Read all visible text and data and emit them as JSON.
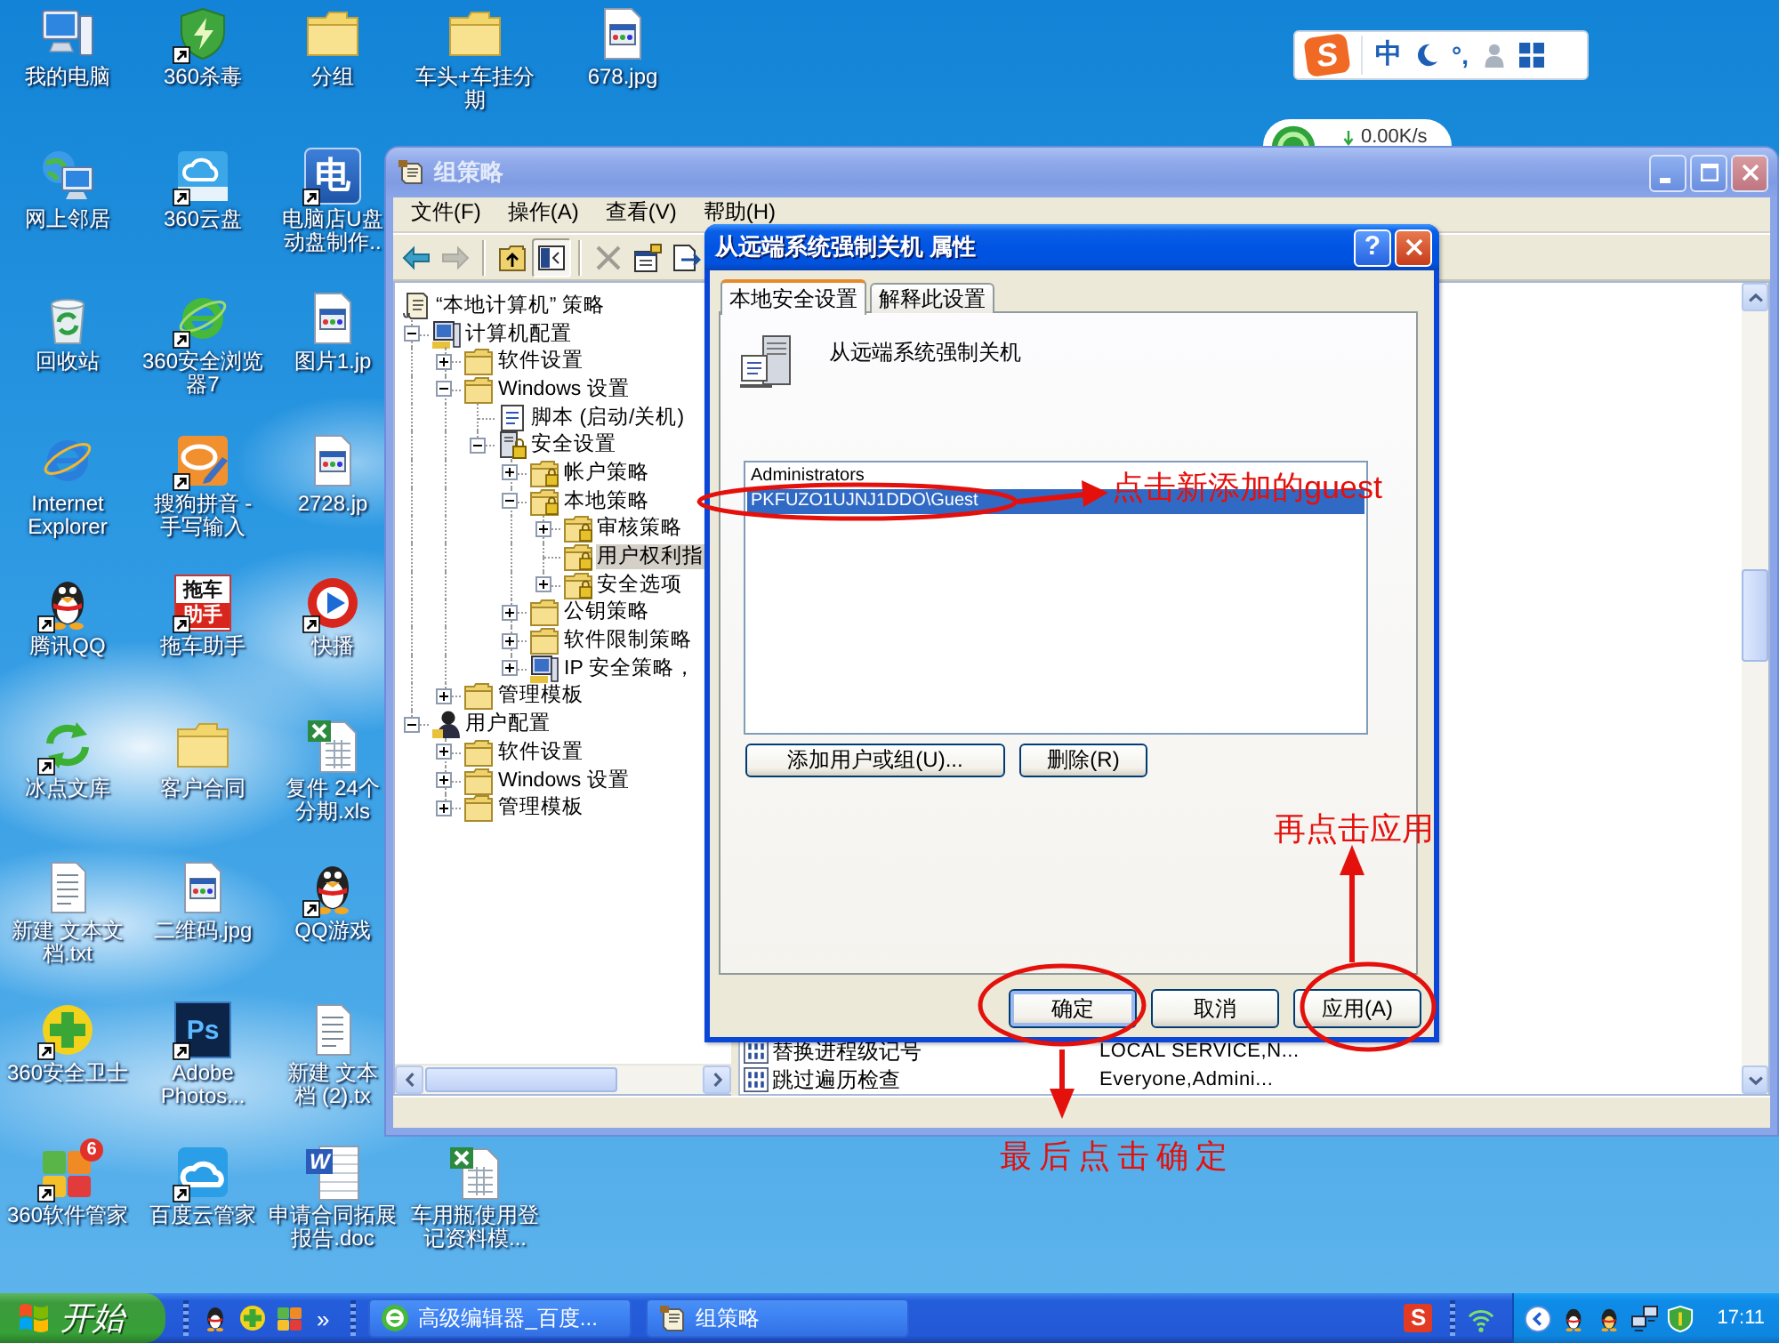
{
  "desktop_icons": [
    [
      {
        "label": "我的电脑",
        "kind": "computer",
        "shortcut": false
      },
      {
        "label": "网上邻居",
        "kind": "network",
        "shortcut": false
      },
      {
        "label": "回收站",
        "kind": "recycle",
        "shortcut": false
      },
      {
        "label": "Internet Explorer",
        "kind": "ie",
        "shortcut": false
      },
      {
        "label": "腾讯QQ",
        "kind": "penguin",
        "shortcut": true
      },
      {
        "label": "冰点文库",
        "kind": "arrows",
        "shortcut": true
      },
      {
        "label": "新建 文本文档.txt",
        "kind": "textfile",
        "shortcut": false
      },
      {
        "label": "360安全卫士",
        "kind": "plus",
        "shortcut": true
      },
      {
        "label": "360软件管家",
        "kind": "apps",
        "shortcut": true,
        "badge": "6"
      }
    ],
    [
      {
        "label": "360杀毒",
        "kind": "shield",
        "shortcut": true
      },
      {
        "label": "360云盘",
        "kind": "cloud",
        "shortcut": true
      },
      {
        "label": "360安全浏览器7",
        "kind": "ering",
        "shortcut": true
      },
      {
        "label": "搜狗拼音 - 手写输入",
        "kind": "pencil",
        "shortcut": true
      },
      {
        "label": "拖车助手",
        "kind": "tow-tile",
        "tile_text": [
          "拖车",
          "助手"
        ],
        "shortcut": true
      },
      {
        "label": "客户合同",
        "kind": "folder",
        "shortcut": false
      },
      {
        "label": "二维码.jpg",
        "kind": "image",
        "shortcut": false
      },
      {
        "label": "Adobe Photos...",
        "kind": "ps-tile",
        "tile_text": [
          "Ps"
        ],
        "shortcut": true
      },
      {
        "label": "百度云管家",
        "kind": "cloud2",
        "shortcut": true
      }
    ],
    [
      {
        "label": "分组",
        "kind": "folder",
        "shortcut": false
      },
      {
        "label": "电脑店U盘动盘制作..",
        "kind": "char-tile",
        "tile_text": [
          "电"
        ],
        "shortcut": true
      },
      {
        "label": "图片1.jp",
        "kind": "image",
        "shortcut": false
      },
      {
        "label": "2728.jp",
        "kind": "image",
        "shortcut": false
      },
      {
        "label": "快播",
        "kind": "play",
        "shortcut": true
      },
      {
        "label": "复件 24个分期.xls",
        "kind": "excel",
        "shortcut": false
      },
      {
        "label": "QQ游戏",
        "kind": "penguin",
        "shortcut": true
      },
      {
        "label": "新建 文本档 (2).tx",
        "kind": "textfile",
        "shortcut": false
      },
      {
        "label": "申请合同拓展报告.doc",
        "kind": "word-doc",
        "tile_text": [
          "W"
        ],
        "shortcut": false
      }
    ],
    [
      {
        "label": "车头+车挂分期",
        "kind": "folder",
        "shortcut": false
      },
      {
        "label": "车用瓶使用登记资料模...",
        "kind": "excel",
        "shortcut": false
      }
    ],
    [
      {
        "label": "678.jpg",
        "kind": "image",
        "shortcut": false
      }
    ]
  ],
  "ime_bar": {
    "logo": "S",
    "mode": "中",
    "punctuation": "°,"
  },
  "net_widget": {
    "speed": "0.00K/s"
  },
  "gp_window": {
    "title": "组策略",
    "menu": [
      "文件(F)",
      "操作(A)",
      "查看(V)",
      "帮助(H)"
    ],
    "toolbar": [
      [
        {
          "kind": "back",
          "disabled": false,
          "pressed": false
        },
        {
          "kind": "forward",
          "disabled": true,
          "pressed": false
        }
      ],
      [
        {
          "kind": "up",
          "disabled": false,
          "pressed": false
        },
        {
          "kind": "tree",
          "disabled": false,
          "pressed": true
        }
      ],
      [
        {
          "kind": "delete",
          "disabled": true,
          "pressed": false
        },
        {
          "kind": "properties",
          "disabled": false,
          "pressed": false
        },
        {
          "kind": "export",
          "disabled": false,
          "pressed": false
        }
      ]
    ],
    "tree": {
      "label": "“本地计算机” 策略",
      "kind": "policy",
      "selected": false,
      "children": [
        {
          "label": "计算机配置",
          "kind": "computer",
          "expanded": true,
          "selected": false,
          "children": [
            {
              "label": "软件设置",
              "kind": "folder",
              "expanded": false,
              "selected": false
            },
            {
              "label": "Windows 设置",
              "kind": "folder",
              "expanded": true,
              "selected": false,
              "children": [
                {
                  "label": "脚本 (启动/关机)",
                  "kind": "script",
                  "selected": false
                },
                {
                  "label": "安全设置",
                  "kind": "security",
                  "expanded": true,
                  "selected": false,
                  "children": [
                    {
                      "label": "帐户策略",
                      "kind": "lock-folder",
                      "expanded": false,
                      "selected": false
                    },
                    {
                      "label": "本地策略",
                      "kind": "lock-folder",
                      "expanded": true,
                      "selected": false,
                      "children": [
                        {
                          "label": "审核策略",
                          "kind": "lock-folder",
                          "expanded": false,
                          "selected": false
                        },
                        {
                          "label": "用户权利指",
                          "kind": "lock-folder",
                          "selected": true
                        },
                        {
                          "label": "安全选项",
                          "kind": "lock-folder",
                          "expanded": false,
                          "selected": false
                        }
                      ]
                    },
                    {
                      "label": "公钥策略",
                      "kind": "folder",
                      "expanded": false,
                      "selected": false
                    },
                    {
                      "label": "软件限制策略",
                      "kind": "folder",
                      "expanded": false,
                      "selected": false
                    },
                    {
                      "label": "IP 安全策略，",
                      "kind": "computer",
                      "expanded": false,
                      "selected": false
                    }
                  ]
                }
              ]
            },
            {
              "label": "管理模板",
              "kind": "folder",
              "expanded": false,
              "selected": false
            }
          ]
        },
        {
          "label": "用户配置",
          "kind": "user",
          "expanded": true,
          "selected": false,
          "children": [
            {
              "label": "软件设置",
              "kind": "folder",
              "expanded": false,
              "selected": false
            },
            {
              "label": "Windows 设置",
              "kind": "folder",
              "expanded": false,
              "selected": false
            },
            {
              "label": "管理模板",
              "kind": "folder",
              "expanded": false,
              "selected": false
            }
          ]
        }
      ]
    },
    "rows": [
      {
        "name": "替换进程级记号",
        "setting": "LOCAL SERVICE,N..."
      },
      {
        "name": "跳过遍历检查",
        "setting": "Everyone,Admini..."
      }
    ]
  },
  "dialog": {
    "title": "从远端系统强制关机 属性",
    "help": "?",
    "tabs": [
      {
        "label": "本地安全设置",
        "selected": true
      },
      {
        "label": "解释此设置",
        "selected": false
      }
    ],
    "policy_name": "从远端系统强制关机",
    "accounts": [
      {
        "name": "Administrators",
        "selected": false
      },
      {
        "name": "PKFUZO1UJNJ1DDO\\Guest",
        "selected": true
      }
    ],
    "list_buttons": [
      "添加用户或组(U)...",
      "删除(R)"
    ],
    "buttons": [
      {
        "label": "确定",
        "default": true
      },
      {
        "label": "取消",
        "default": false
      },
      {
        "label": "应用(A)",
        "default": false
      }
    ]
  },
  "annotations": {
    "guest_note": "点击新添加的guest",
    "apply_note": "再点击应用",
    "ok_note": "最后点击确定"
  },
  "taskbar": {
    "start": "开始",
    "more": "»",
    "tasks": [
      {
        "label": "高级编辑器_百度...",
        "kind": "browser"
      },
      {
        "label": "组策略",
        "kind": "policy"
      }
    ],
    "tray_logo": "S",
    "clock": "17:11"
  }
}
